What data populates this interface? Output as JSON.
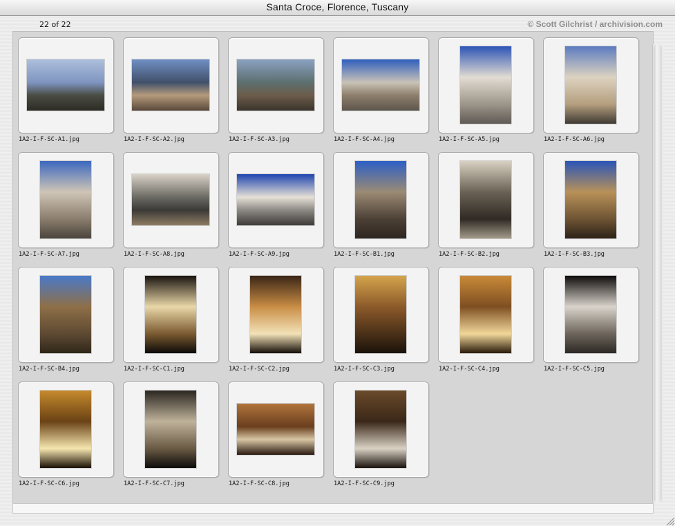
{
  "window": {
    "title": "Santa Croce, Florence, Tuscany"
  },
  "info": {
    "count": "22 of 22",
    "credit": "© Scott Gilchrist / archivision.com"
  },
  "thumbnails": [
    {
      "filename": "1A2-I-F-SC-A1.jpg",
      "orientation": "landscape",
      "colors": [
        "#aebfdd",
        "#7e95c0",
        "#4a4d44",
        "#2c2b25"
      ]
    },
    {
      "filename": "1A2-I-F-SC-A2.jpg",
      "orientation": "landscape",
      "colors": [
        "#6f8fc4",
        "#41506a",
        "#b59a7c",
        "#59493a"
      ]
    },
    {
      "filename": "1A2-I-F-SC-A3.jpg",
      "orientation": "landscape",
      "colors": [
        "#8aa2c2",
        "#5c6f6f",
        "#6c5c4a",
        "#3a342c"
      ]
    },
    {
      "filename": "1A2-I-F-SC-A4.jpg",
      "orientation": "landscape",
      "colors": [
        "#2f5fbd",
        "#c9c3b7",
        "#8e7f6c",
        "#5d554c"
      ]
    },
    {
      "filename": "1A2-I-F-SC-A5.jpg",
      "orientation": "portrait",
      "colors": [
        "#2d55b5",
        "#e2dcd2",
        "#9b958a",
        "#5f5a55"
      ]
    },
    {
      "filename": "1A2-I-F-SC-A6.jpg",
      "orientation": "portrait",
      "colors": [
        "#5c7bc0",
        "#ddd3c0",
        "#b49e7e",
        "#3f3a33"
      ]
    },
    {
      "filename": "1A2-I-F-SC-A7.jpg",
      "orientation": "portrait",
      "colors": [
        "#3c68bf",
        "#cfc5b6",
        "#8a7d6d",
        "#4a443d"
      ]
    },
    {
      "filename": "1A2-I-F-SC-A8.jpg",
      "orientation": "landscape",
      "colors": [
        "#d9d2c7",
        "#6b6a63",
        "#3b3a37",
        "#8e7c63"
      ]
    },
    {
      "filename": "1A2-I-F-SC-A9.jpg",
      "orientation": "landscape",
      "colors": [
        "#1f45b0",
        "#e6e0d6",
        "#8d8a85",
        "#3d3a37"
      ]
    },
    {
      "filename": "1A2-I-F-SC-B1.jpg",
      "orientation": "portrait",
      "colors": [
        "#2d5fc6",
        "#9b8b74",
        "#4c4036",
        "#2d2620"
      ]
    },
    {
      "filename": "1A2-I-F-SC-B2.jpg",
      "orientation": "portrait",
      "colors": [
        "#d8d1c2",
        "#6a6254",
        "#2f2a24",
        "#a39a8a"
      ]
    },
    {
      "filename": "1A2-I-F-SC-B3.jpg",
      "orientation": "portrait",
      "colors": [
        "#2a55b8",
        "#b89158",
        "#6e5434",
        "#2c2217"
      ]
    },
    {
      "filename": "1A2-I-F-SC-B4.jpg",
      "orientation": "portrait",
      "colors": [
        "#4a79c8",
        "#8e6f47",
        "#5e4a33",
        "#2f2618"
      ]
    },
    {
      "filename": "1A2-I-F-SC-C1.jpg",
      "orientation": "portrait",
      "colors": [
        "#1a1410",
        "#e9d7a8",
        "#7a5a30",
        "#0c0a08"
      ]
    },
    {
      "filename": "1A2-I-F-SC-C2.jpg",
      "orientation": "portrait",
      "colors": [
        "#3a2616",
        "#c98d45",
        "#f2e2b8",
        "#150e08"
      ]
    },
    {
      "filename": "1A2-I-F-SC-C3.jpg",
      "orientation": "portrait",
      "colors": [
        "#d4a44c",
        "#8c5a2a",
        "#4a3018",
        "#1a120a"
      ]
    },
    {
      "filename": "1A2-I-F-SC-C4.jpg",
      "orientation": "portrait",
      "colors": [
        "#c98a38",
        "#7e4f22",
        "#f1d79a",
        "#2a1a0c"
      ]
    },
    {
      "filename": "1A2-I-F-SC-C5.jpg",
      "orientation": "portrait",
      "colors": [
        "#0e0c0b",
        "#d9d3cb",
        "#6d655c",
        "#2c2824"
      ]
    },
    {
      "filename": "1A2-I-F-SC-C6.jpg",
      "orientation": "portrait",
      "colors": [
        "#c68a2d",
        "#6a4215",
        "#f5e6b0",
        "#1a0f05"
      ]
    },
    {
      "filename": "1A2-I-F-SC-C7.jpg",
      "orientation": "portrait",
      "colors": [
        "#2a2620",
        "#bfb29a",
        "#6a5a44",
        "#0d0b09"
      ]
    },
    {
      "filename": "1A2-I-F-SC-C8.jpg",
      "orientation": "landscape",
      "colors": [
        "#b0743b",
        "#6a3e1e",
        "#d8c6a4",
        "#2a1a10"
      ]
    },
    {
      "filename": "1A2-I-F-SC-C9.jpg",
      "orientation": "portrait",
      "colors": [
        "#6a4a2a",
        "#3a2718",
        "#d9d2c4",
        "#1a120c"
      ]
    }
  ]
}
